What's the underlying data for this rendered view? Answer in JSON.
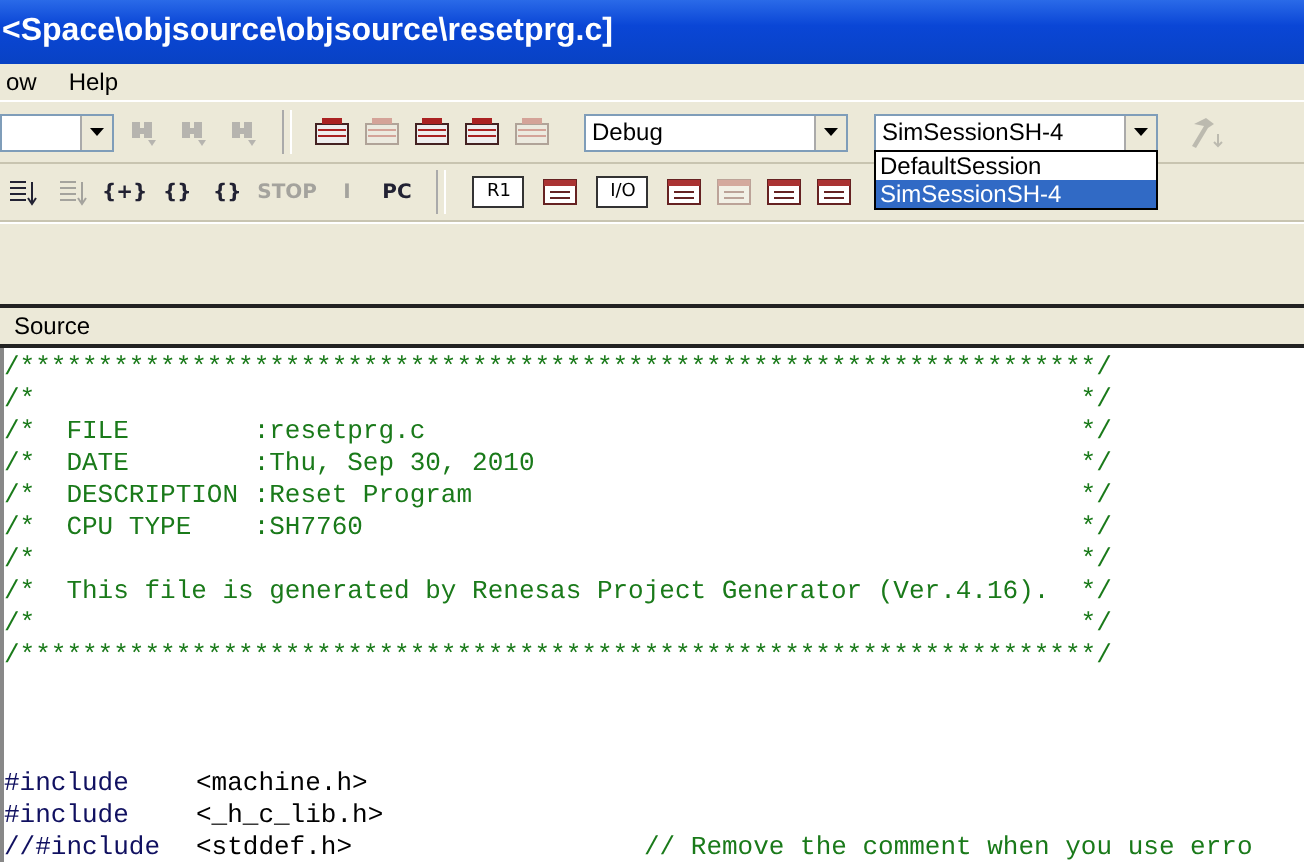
{
  "window": {
    "title": "<Space\\objsource\\objsource\\resetprg.c]"
  },
  "menu": [
    "ow",
    "Help"
  ],
  "toolbar1": {
    "tools_a": [
      {
        "disabled": true
      },
      {
        "disabled": true
      },
      {
        "disabled": true
      }
    ],
    "tools_b": [
      {
        "disabled": false
      },
      {
        "disabled": true
      },
      {
        "disabled": false
      },
      {
        "disabled": false
      },
      {
        "disabled": true
      }
    ],
    "config_combo": {
      "value": "Debug"
    },
    "session_combo": {
      "value": "SimSessionSH-4",
      "expanded": true,
      "options": [
        {
          "label": "DefaultSession",
          "selected": false
        },
        {
          "label": "SimSessionSH-4",
          "selected": true
        }
      ]
    },
    "tools_c": [
      {
        "disabled": true
      }
    ]
  },
  "toolbar2": {
    "tools_a": [
      {
        "disabled": false
      },
      {
        "disabled": true
      },
      {
        "label": "{+}",
        "disabled": false
      },
      {
        "label": "{}",
        "disabled": false
      },
      {
        "label": "{}",
        "disabled": false
      },
      {
        "label": "STOP",
        "disabled": true
      },
      {
        "label": "I",
        "disabled": true
      },
      {
        "label": "PC",
        "disabled": false
      }
    ],
    "tools_b": [
      {
        "label": "R1",
        "disabled": false
      },
      {
        "disabled": false
      },
      {
        "label": "I/O",
        "disabled": false
      },
      {
        "disabled": false
      },
      {
        "disabled": true
      },
      {
        "disabled": false
      },
      {
        "disabled": false
      }
    ]
  },
  "pane": {
    "title": "Source"
  },
  "code": [
    {
      "kind": "comment",
      "text": "/*********************************************************************/"
    },
    {
      "kind": "comment",
      "text": "/*                                                                   */"
    },
    {
      "kind": "comment",
      "text": "/*  FILE        :resetprg.c                                          */"
    },
    {
      "kind": "comment",
      "text": "/*  DATE        :Thu, Sep 30, 2010                                   */"
    },
    {
      "kind": "comment",
      "text": "/*  DESCRIPTION :Reset Program                                       */"
    },
    {
      "kind": "comment",
      "text": "/*  CPU TYPE    :SH7760                                              */"
    },
    {
      "kind": "comment",
      "text": "/*                                                                   */"
    },
    {
      "kind": "comment",
      "text": "/*  This file is generated by Renesas Project Generator (Ver.4.16).  */"
    },
    {
      "kind": "comment",
      "text": "/*                                                                   */"
    },
    {
      "kind": "comment",
      "text": "/*********************************************************************/"
    },
    {
      "kind": "blank"
    },
    {
      "kind": "blank"
    },
    {
      "kind": "blank"
    },
    {
      "kind": "include",
      "directive": "#include",
      "header": "<machine.h>"
    },
    {
      "kind": "include",
      "directive": "#include",
      "header": "<_h_c_lib.h>"
    },
    {
      "kind": "include",
      "directive": "//#include",
      "header": "<stddef.h>",
      "note": "// Remove the comment when you use erro"
    }
  ]
}
